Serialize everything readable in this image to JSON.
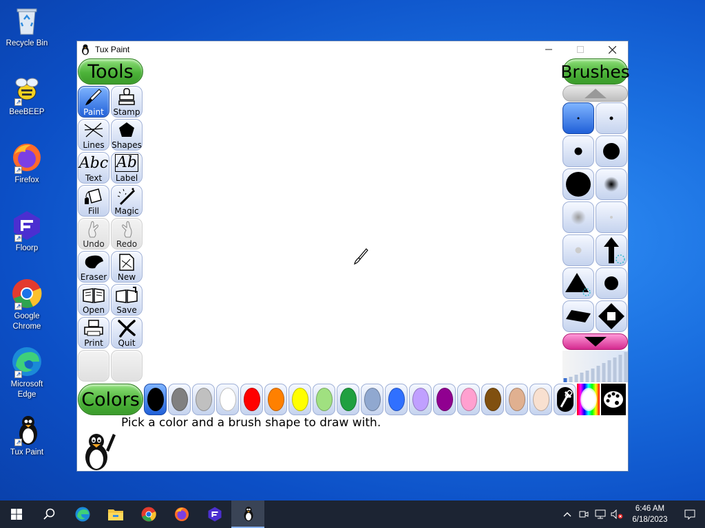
{
  "desktop": {
    "icons": [
      {
        "label": "Recycle Bin",
        "icon": "recycle-bin-icon"
      },
      {
        "label": "BeeBEEP",
        "icon": "beebeep-icon"
      },
      {
        "label": "Firefox",
        "icon": "firefox-icon"
      },
      {
        "label": "Floorp",
        "icon": "floorp-icon"
      },
      {
        "label": "Google Chrome",
        "icon": "chrome-icon"
      },
      {
        "label": "Microsoft Edge",
        "icon": "edge-icon"
      },
      {
        "label": "Tux Paint",
        "icon": "tux-paint-icon"
      }
    ]
  },
  "window": {
    "title": "Tux Paint",
    "controls": {
      "minimize": "—",
      "maximize": "☐",
      "close": "✕"
    }
  },
  "tools": {
    "header": "Tools",
    "items": [
      {
        "label": "Paint",
        "icon": "paintbrush-icon",
        "selected": true
      },
      {
        "label": "Stamp",
        "icon": "stamp-icon"
      },
      {
        "label": "Lines",
        "icon": "lines-icon"
      },
      {
        "label": "Shapes",
        "icon": "pentagon-icon"
      },
      {
        "label": "Text",
        "icon": "text-icon"
      },
      {
        "label": "Label",
        "icon": "label-icon"
      },
      {
        "label": "Fill",
        "icon": "paint-bucket-icon"
      },
      {
        "label": "Magic",
        "icon": "magic-wand-icon"
      },
      {
        "label": "Undo",
        "icon": "undo-hand-icon",
        "disabled": true
      },
      {
        "label": "Redo",
        "icon": "redo-hand-icon",
        "disabled": true
      },
      {
        "label": "Eraser",
        "icon": "eraser-icon"
      },
      {
        "label": "New",
        "icon": "new-page-icon"
      },
      {
        "label": "Open",
        "icon": "open-book-icon"
      },
      {
        "label": "Save",
        "icon": "save-book-icon"
      },
      {
        "label": "Print",
        "icon": "printer-icon"
      },
      {
        "label": "Quit",
        "icon": "quit-icon"
      }
    ]
  },
  "brushes": {
    "header": "Brushes",
    "scroll_up_icon": "triangle-up-icon",
    "scroll_down_icon": "triangle-down-icon"
  },
  "colors": {
    "header": "Colors",
    "swatches": [
      "#000000",
      "#808080",
      "#c0c0c0",
      "#ffffff",
      "#ff0000",
      "#ff8000",
      "#ffff00",
      "#a0e080",
      "#20a040",
      "#90a8d0",
      "#3070ff",
      "#c0a0ff",
      "#900090",
      "#ffa0d0",
      "#805010",
      "#e0b090",
      "#f8e0d0"
    ],
    "selected_index": 0
  },
  "status": {
    "message": "Pick a color and a brush shape to draw with."
  },
  "taskbar": {
    "items": [
      "start-icon",
      "search-icon",
      "edge-icon",
      "file-explorer-icon",
      "chrome-icon",
      "firefox-icon",
      "floorp-icon",
      "tux-paint-icon"
    ],
    "active_index": 7,
    "time": "6:46 AM",
    "date": "6/18/2023"
  }
}
